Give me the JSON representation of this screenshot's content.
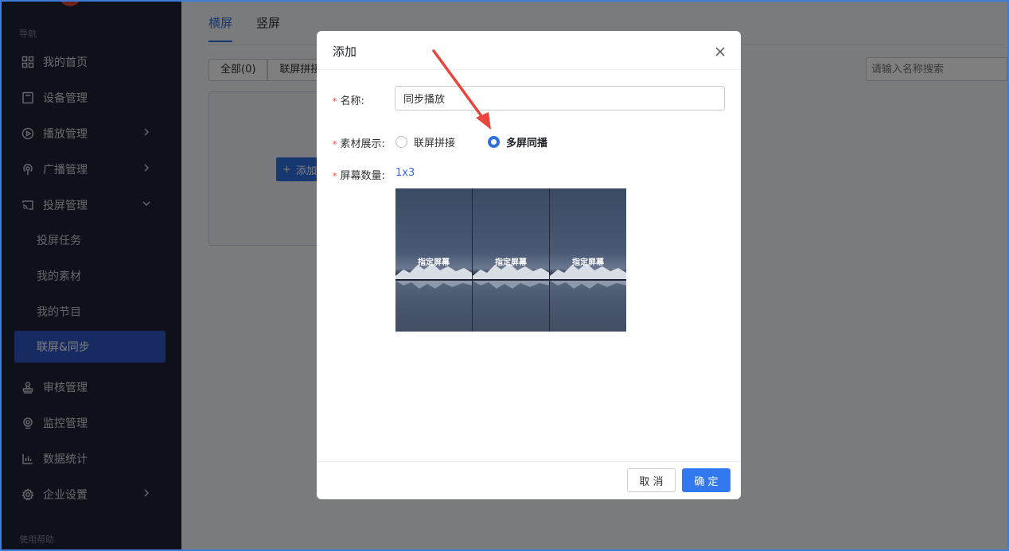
{
  "sidebar": {
    "nav_heading": "导航",
    "help_heading": "使用帮助",
    "items": [
      {
        "label": "我的首页",
        "icon": "grid-icon"
      },
      {
        "label": "设备管理",
        "icon": "device-icon"
      },
      {
        "label": "播放管理",
        "icon": "play-icon"
      },
      {
        "label": "广播管理",
        "icon": "broadcast-icon"
      },
      {
        "label": "投屏管理",
        "icon": "cast-icon"
      },
      {
        "label": "审核管理",
        "icon": "stamp-icon"
      },
      {
        "label": "监控管理",
        "icon": "camera-icon"
      },
      {
        "label": "数据统计",
        "icon": "chart-icon"
      },
      {
        "label": "企业设置",
        "icon": "gear-icon"
      }
    ],
    "sub_items": [
      "投屏任务",
      "我的素材",
      "我的节目",
      "联屏&同步"
    ]
  },
  "main": {
    "tabs": [
      "横屏",
      "竖屏"
    ],
    "filters": [
      "全部(0)",
      "联屏拼接"
    ],
    "search_placeholder": "请输入名称搜索",
    "add_button": "添加"
  },
  "modal": {
    "title": "添加",
    "name_label": "名称:",
    "name_value": "同步播放",
    "material_label": "素材展示:",
    "radio_options": [
      "联屏拼接",
      "多屏同播"
    ],
    "selected_option": "多屏同播",
    "screen_count_label": "屏幕数量:",
    "screen_count_value": "1x3",
    "preview_panels": [
      "指定屏幕",
      "指定屏幕",
      "指定屏幕"
    ],
    "cancel_label": "取 消",
    "ok_label": "确 定"
  },
  "colors": {
    "accent": "#2f6fe0",
    "sidebar_bg": "#1c2232",
    "active_item": "#2f55c5",
    "required": "#e0443a",
    "annotation_arrow": "#e8453c"
  }
}
